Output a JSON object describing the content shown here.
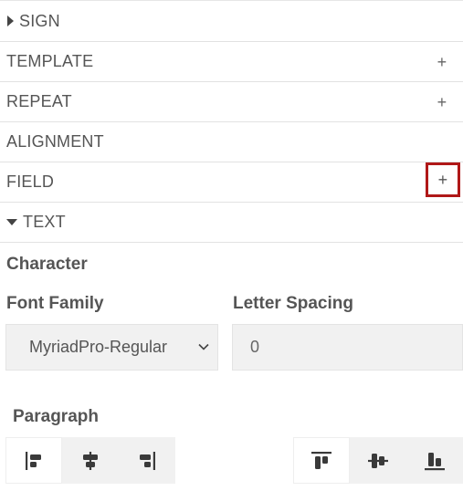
{
  "sections": {
    "sign": {
      "label": "SIGN",
      "expanded": false
    },
    "template": {
      "label": "TEMPLATE",
      "action": "+"
    },
    "repeat": {
      "label": "REPEAT",
      "action": "+"
    },
    "alignment": {
      "label": "ALIGNMENT"
    },
    "field": {
      "label": "FIELD",
      "action": "+",
      "highlighted": true
    },
    "text": {
      "label": "TEXT",
      "expanded": true
    }
  },
  "text_panel": {
    "character_heading": "Character",
    "font_family": {
      "label": "Font Family",
      "value": "MyriadPro-Regular"
    },
    "letter_spacing": {
      "label": "Letter Spacing",
      "value": "0"
    },
    "paragraph_heading": "Paragraph",
    "horizontal_align": {
      "options": [
        "left",
        "center",
        "right"
      ],
      "selected": "left"
    },
    "vertical_align": {
      "options": [
        "top",
        "middle",
        "bottom"
      ],
      "selected": "top"
    }
  },
  "colors": {
    "highlight_border": "#b01818",
    "field_bg": "#f1f1f1",
    "icon": "#3a3a3a"
  }
}
